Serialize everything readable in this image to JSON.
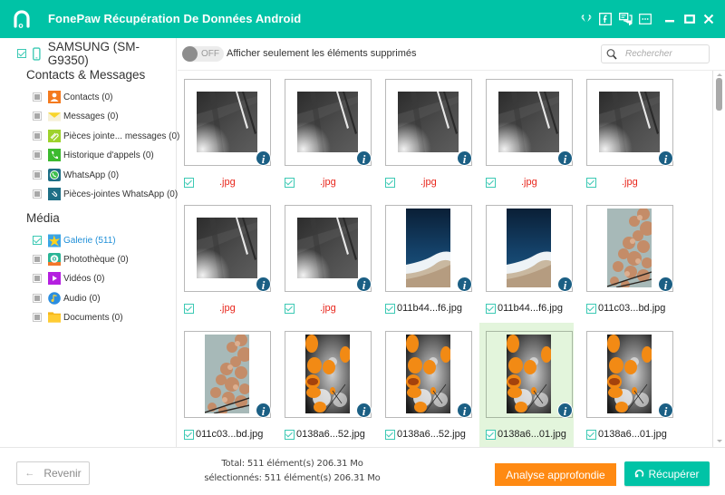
{
  "window": {
    "title": "FonePaw Récupération De Données Android",
    "accent_color": "#00c3a6",
    "titlebar_icons": [
      "diamond-icon",
      "facebook-icon",
      "feedback-icon",
      "menu-icon",
      "minimize-icon",
      "maximize-icon",
      "close-icon"
    ]
  },
  "sidebar": {
    "device": {
      "label": "SAMSUNG (SM-G9350)",
      "checked": true
    },
    "sections": [
      {
        "title": "Contacts & Messages",
        "items": [
          {
            "label": "Contacts (0)",
            "icon": "contacts-icon",
            "checked": false,
            "active": false
          },
          {
            "label": "Messages (0)",
            "icon": "messages-icon",
            "checked": false,
            "active": false
          },
          {
            "label": "Pièces jointe... messages (0)",
            "icon": "attachments-icon",
            "checked": false,
            "active": false
          },
          {
            "label": "Historique d'appels (0)",
            "icon": "call-log-icon",
            "checked": false,
            "active": false
          },
          {
            "label": "WhatsApp (0)",
            "icon": "whatsapp-icon",
            "checked": false,
            "active": false
          },
          {
            "label": "Pièces-jointes WhatsApp (0)",
            "icon": "whatsapp-attachments-icon",
            "checked": false,
            "active": false
          }
        ]
      },
      {
        "title": "Média",
        "items": [
          {
            "label": "Galerie (511)",
            "icon": "gallery-icon",
            "checked": true,
            "active": true
          },
          {
            "label": "Photothèque (0)",
            "icon": "photo-library-icon",
            "checked": false,
            "active": false
          },
          {
            "label": "Vidéos (0)",
            "icon": "videos-icon",
            "checked": false,
            "active": false
          },
          {
            "label": "Audio (0)",
            "icon": "audio-icon",
            "checked": false,
            "active": false
          },
          {
            "label": "Documents (0)",
            "icon": "documents-icon",
            "checked": false,
            "active": false
          }
        ]
      }
    ]
  },
  "toolbar": {
    "toggle_state": "OFF",
    "toggle_label": "Afficher seulement les éléments supprimés",
    "search_placeholder": "Rechercher",
    "search_value": ""
  },
  "grid": {
    "items": [
      {
        "name": ".jpg",
        "deleted": true,
        "thumb": "dark",
        "checked": true,
        "selected": false
      },
      {
        "name": ".jpg",
        "deleted": true,
        "thumb": "dark",
        "checked": true,
        "selected": false
      },
      {
        "name": ".jpg",
        "deleted": true,
        "thumb": "dark",
        "checked": true,
        "selected": false
      },
      {
        "name": ".jpg",
        "deleted": true,
        "thumb": "dark",
        "checked": true,
        "selected": false
      },
      {
        "name": ".jpg",
        "deleted": true,
        "thumb": "dark",
        "checked": true,
        "selected": false
      },
      {
        "name": ".jpg",
        "deleted": true,
        "thumb": "dark",
        "checked": true,
        "selected": false
      },
      {
        "name": ".jpg",
        "deleted": true,
        "thumb": "dark",
        "checked": true,
        "selected": false
      },
      {
        "name": "011b44...f6.jpg",
        "deleted": false,
        "thumb": "ocean",
        "checked": true,
        "selected": false
      },
      {
        "name": "011b44...f6.jpg",
        "deleted": false,
        "thumb": "ocean",
        "checked": true,
        "selected": false
      },
      {
        "name": "011c03...bd.jpg",
        "deleted": false,
        "thumb": "blossom",
        "checked": true,
        "selected": false
      },
      {
        "name": "011c03...bd.jpg",
        "deleted": false,
        "thumb": "blossom",
        "checked": true,
        "selected": false
      },
      {
        "name": "0138a6...52.jpg",
        "deleted": false,
        "thumb": "leaves",
        "checked": true,
        "selected": false
      },
      {
        "name": "0138a6...52.jpg",
        "deleted": false,
        "thumb": "leaves",
        "checked": true,
        "selected": false
      },
      {
        "name": "0138a6...01.jpg",
        "deleted": false,
        "thumb": "leaves",
        "checked": true,
        "selected": true
      },
      {
        "name": "0138a6...01.jpg",
        "deleted": false,
        "thumb": "leaves",
        "checked": true,
        "selected": false
      }
    ]
  },
  "footer": {
    "back_label": "Revenir",
    "total_text": "Total: 511 élément(s) 206.31 Mo",
    "selected_text": "sélectionnés: 511 élément(s) 206.31 Mo",
    "deep_scan_label": "Analyse approfondie",
    "recover_label": "Récupérer",
    "deep_scan_color": "#ff8a12",
    "recover_color": "#00c3a6"
  }
}
